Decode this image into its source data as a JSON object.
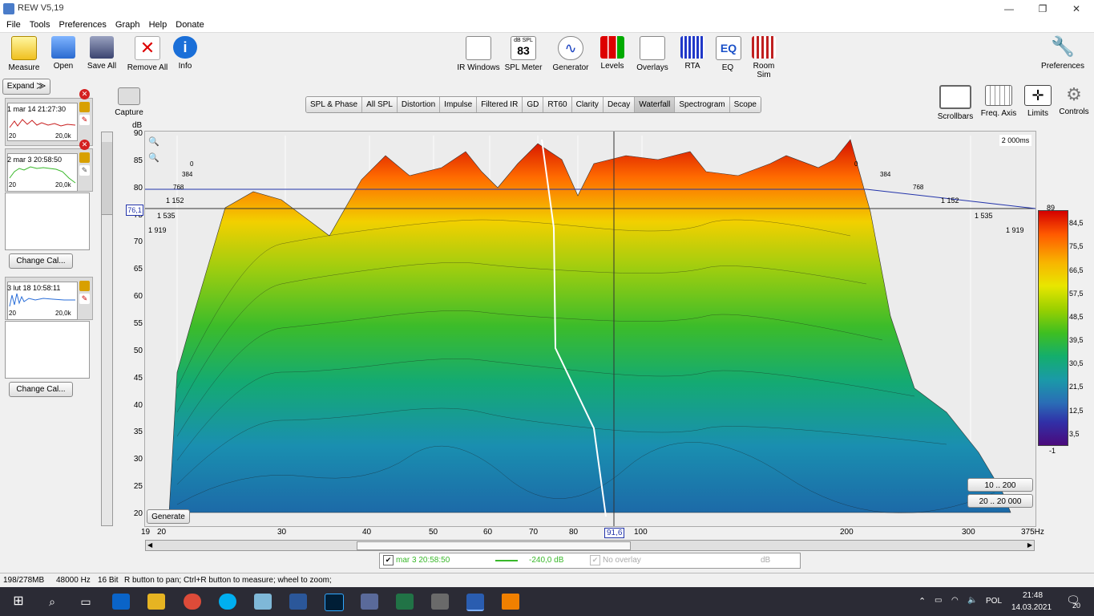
{
  "window": {
    "title": "REW V5,19"
  },
  "menu": [
    "File",
    "Tools",
    "Preferences",
    "Graph",
    "Help",
    "Donate"
  ],
  "toolbar": {
    "left": [
      "Measure",
      "Open",
      "Save All",
      "Remove All",
      "Info"
    ],
    "center": [
      "IR Windows",
      "SPL Meter",
      "Generator",
      "Levels",
      "Overlays",
      "RTA",
      "EQ",
      "Room Sim"
    ],
    "spl_meter_top": "dB SPL",
    "spl_meter_value": "83",
    "right": "Preferences",
    "capture": "Capture",
    "graph_right": [
      "Scrollbars",
      "Freq. Axis",
      "Limits",
      "Controls"
    ]
  },
  "tabs": [
    "SPL & Phase",
    "All SPL",
    "Distortion",
    "Impulse",
    "Filtered IR",
    "GD",
    "RT60",
    "Clarity",
    "Decay",
    "Waterfall",
    "Spectrogram",
    "Scope"
  ],
  "active_tab": "Waterfall",
  "expand_label": "Expand",
  "measurements": [
    {
      "label": "1 mar 14 21:27:30",
      "x_start": "20",
      "x_end": "20,0k",
      "color": "#c81e1e"
    },
    {
      "label": "2 mar 3 20:58:50",
      "x_start": "20",
      "x_end": "20,0k",
      "color": "#39b82a"
    },
    {
      "label": "3 lut 18 10:58:11",
      "x_start": "20",
      "x_end": "20,0k",
      "color": "#2a6ed8"
    }
  ],
  "change_cal": "Change Cal...",
  "graph": {
    "y_unit": "dB",
    "y_ticks": [
      "90",
      "85",
      "80",
      "75",
      "70",
      "65",
      "60",
      "55",
      "50",
      "45",
      "40",
      "35",
      "30",
      "25",
      "20"
    ],
    "x_ticks": [
      "19",
      "20",
      "30",
      "40",
      "50",
      "60",
      "70",
      "80",
      "91,6",
      "100",
      "200",
      "300",
      "375Hz"
    ],
    "cursor_y": "76,1",
    "time_label": "2 000ms",
    "time_ticks_left": [
      "0",
      "384",
      "768",
      "1 152",
      "1 535",
      "1 919"
    ],
    "time_ticks_right": [
      "0",
      "384",
      "768",
      "1 152",
      "1 535",
      "1 919"
    ],
    "colorbar_ticks": [
      "89",
      "84,5",
      "75,5",
      "66,5",
      "57,5",
      "48,5",
      "39,5",
      "30,5",
      "21,5",
      "12,5",
      "3,5",
      "-1"
    ],
    "range_btn1": "10 .. 200",
    "range_btn2": "20 .. 20 000",
    "generate": "Generate"
  },
  "legend": {
    "name": "mar 3 20:58:50",
    "value": "-240,0 dB",
    "overlay": "No overlay",
    "unit": "dB",
    "color": "#39b82a"
  },
  "status": {
    "memory": "198/278MB",
    "rate": "48000 Hz",
    "bits": "16 Bit",
    "hint": "R button to pan; Ctrl+R button to measure; wheel to zoom;"
  },
  "taskbar": {
    "lang": "POL",
    "time": "21:48",
    "date": "14.03.2021",
    "badge": "20"
  }
}
